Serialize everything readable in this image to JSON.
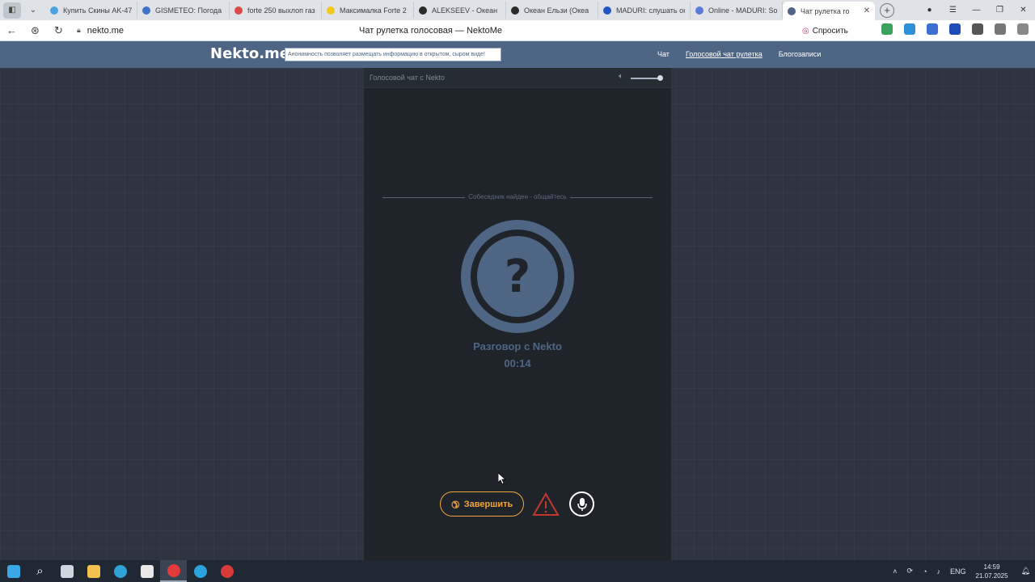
{
  "browser": {
    "tabs": [
      {
        "title": "Купить Скины AK-47",
        "color": "#4aa3df"
      },
      {
        "title": "GISMETEO: Погода в",
        "color": "#3f73c6"
      },
      {
        "title": "forte 250 выхлоп газ",
        "color": "#d94a4a"
      },
      {
        "title": "Максималка Forte 2",
        "color": "#f2c81b"
      },
      {
        "title": "ALEKSEEV - Океан",
        "color": "#2b2b2b"
      },
      {
        "title": "Океан Ельзи (Океа",
        "color": "#2b2b2b"
      },
      {
        "title": "MADURI: слушать он",
        "color": "#2355c7"
      },
      {
        "title": "Online - MADURI: So",
        "color": "#5b7bd8"
      },
      {
        "title": "Чат рулетка го",
        "color": "#4e6683",
        "active": true
      }
    ],
    "new_tab": "+",
    "url": "nekto.me",
    "page_title": "Чат рулетка голосовая — NektoMe",
    "ask_label": "Спросить"
  },
  "site": {
    "logo": "Nekto.me",
    "notice": "Анонимность позволяет размещать информацию в открытом, сыром виде!",
    "nav": [
      "Чат",
      "Голосовой чат рулетка",
      "Блогозаписи"
    ]
  },
  "panel": {
    "title": "Голосовой чат с Nekto",
    "status": "Собеседник найден - общайтесь",
    "avatar_symbol": "?",
    "talk_label": "Разговор с Nekto",
    "timer": "00:14",
    "end_button": "Завершить"
  },
  "taskbar": {
    "lang": "ENG",
    "time": "14:59",
    "date": "21.07.2025"
  },
  "colors": {
    "accent": "#4e6683",
    "end_button": "#f0a43a",
    "report": "#c0392b",
    "panel_bg": "#1f242b"
  }
}
